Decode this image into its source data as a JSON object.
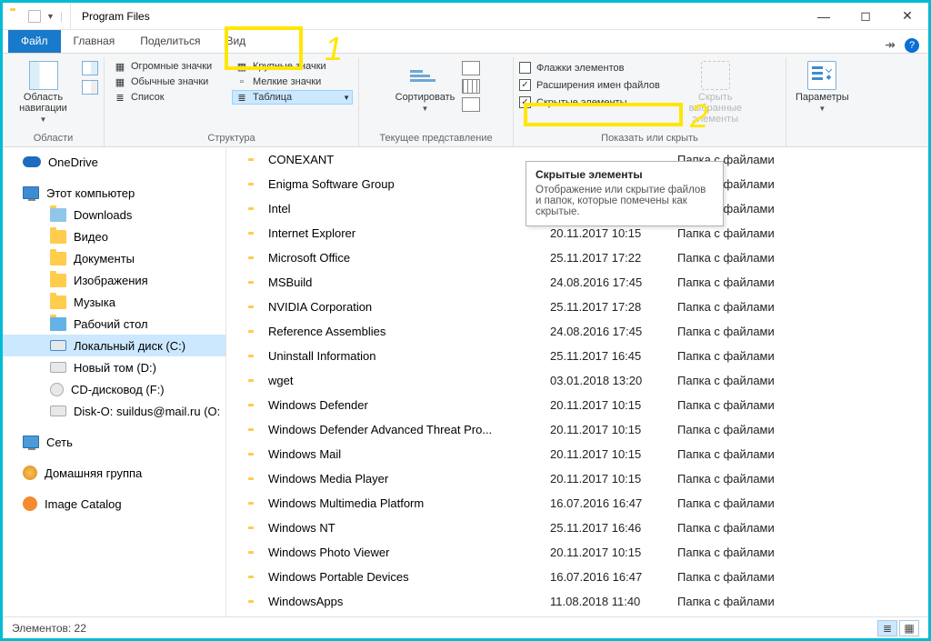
{
  "window": {
    "title": "Program Files"
  },
  "tabs": {
    "file": "Файл",
    "home": "Главная",
    "share": "Поделиться",
    "view": "Вид"
  },
  "ribbon": {
    "panes": {
      "navigation_btn": "Область навигации",
      "group_label": "Области"
    },
    "layout": {
      "extra_large": "Огромные значки",
      "large": "Крупные значки",
      "medium": "Обычные значки",
      "small": "Мелкие значки",
      "list": "Список",
      "table": "Таблица",
      "group_label": "Структура"
    },
    "current_view": {
      "sort": "Сортировать",
      "group_label": "Текущее представление"
    },
    "show_hide": {
      "item_checkboxes": "Флажки элементов",
      "file_ext": "Расширения имен файлов",
      "hidden_items": "Скрытые элементы",
      "hide_selected": "Скрыть выбранные элементы",
      "group_label": "Показать или скрыть"
    },
    "options": {
      "btn": "Параметры"
    }
  },
  "tooltip": {
    "title": "Скрытые элементы",
    "body": "Отображение или скрытие файлов и папок, которые помечены как скрытые."
  },
  "annotations": {
    "n1": "1",
    "n2": "2"
  },
  "nav": {
    "onedrive": "OneDrive",
    "this_pc": "Этот компьютер",
    "downloads": "Downloads",
    "videos": "Видео",
    "documents": "Документы",
    "pictures": "Изображения",
    "music": "Музыка",
    "desktop": "Рабочий стол",
    "disk_c": "Локальный диск (C:)",
    "disk_d": "Новый том (D:)",
    "disk_f": "CD-дисковод (F:)",
    "disk_o": "Disk-O: suildus@mail.ru (O:",
    "network": "Сеть",
    "homegroup": "Домашняя группа",
    "image_catalog": "Image Catalog"
  },
  "files": [
    {
      "name": "CONEXANT",
      "date": "",
      "type": "Папка с файлами"
    },
    {
      "name": "Enigma Software Group",
      "date": "",
      "type": "Папка с файлами"
    },
    {
      "name": "Intel",
      "date": "",
      "type": "Папка с файлами"
    },
    {
      "name": "Internet Explorer",
      "date": "20.11.2017 10:15",
      "type": "Папка с файлами"
    },
    {
      "name": "Microsoft Office",
      "date": "25.11.2017 17:22",
      "type": "Папка с файлами"
    },
    {
      "name": "MSBuild",
      "date": "24.08.2016 17:45",
      "type": "Папка с файлами"
    },
    {
      "name": "NVIDIA Corporation",
      "date": "25.11.2017 17:28",
      "type": "Папка с файлами"
    },
    {
      "name": "Reference Assemblies",
      "date": "24.08.2016 17:45",
      "type": "Папка с файлами"
    },
    {
      "name": "Uninstall Information",
      "date": "25.11.2017 16:45",
      "type": "Папка с файлами"
    },
    {
      "name": "wget",
      "date": "03.01.2018 13:20",
      "type": "Папка с файлами"
    },
    {
      "name": "Windows Defender",
      "date": "20.11.2017 10:15",
      "type": "Папка с файлами"
    },
    {
      "name": "Windows Defender Advanced Threat Pro...",
      "date": "20.11.2017 10:15",
      "type": "Папка с файлами"
    },
    {
      "name": "Windows Mail",
      "date": "20.11.2017 10:15",
      "type": "Папка с файлами"
    },
    {
      "name": "Windows Media Player",
      "date": "20.11.2017 10:15",
      "type": "Папка с файлами"
    },
    {
      "name": "Windows Multimedia Platform",
      "date": "16.07.2016 16:47",
      "type": "Папка с файлами"
    },
    {
      "name": "Windows NT",
      "date": "25.11.2017 16:46",
      "type": "Папка с файлами"
    },
    {
      "name": "Windows Photo Viewer",
      "date": "20.11.2017 10:15",
      "type": "Папка с файлами"
    },
    {
      "name": "Windows Portable Devices",
      "date": "16.07.2016 16:47",
      "type": "Папка с файлами"
    },
    {
      "name": "WindowsApps",
      "date": "11.08.2018 11:40",
      "type": "Папка с файлами"
    }
  ],
  "status": {
    "count_label": "Элементов: 22"
  }
}
